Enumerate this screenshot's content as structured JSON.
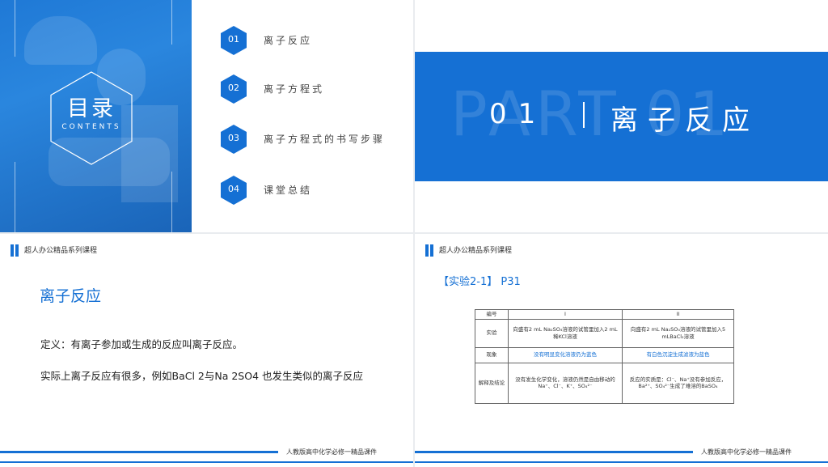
{
  "slide1": {
    "toc_title": "目录",
    "toc_subtitle": "CONTENTS",
    "items": [
      {
        "num": "01",
        "label": "离子反应"
      },
      {
        "num": "02",
        "label": "离子方程式"
      },
      {
        "num": "03",
        "label": "离子方程式的书写步骤"
      },
      {
        "num": "04",
        "label": "课堂总结"
      }
    ]
  },
  "slide2": {
    "bg_text": "PART 01",
    "num": "01",
    "title": "离子反应"
  },
  "slide3": {
    "header": "超人办公精品系列课程",
    "title": "离子反应",
    "para1": "定义：有离子参加或生成的反应叫离子反应。",
    "para2": "实际上离子反应有很多，例如BaCl 2与Na 2SO4 也发生类似的离子反应",
    "footer": "人教版高中化学必修一精品课件"
  },
  "slide4": {
    "header": "超人办公精品系列课程",
    "title": "【实验2-1】  P31",
    "footer": "人教版高中化学必修一精品课件",
    "table": {
      "head": [
        "编号",
        "I",
        "II"
      ],
      "rows": [
        {
          "label": "实验",
          "c1": "向盛有2 mL Na₂SO₄溶液的试管里加入2 mL稀KCl溶液",
          "c2": "向盛有2 mL Na₂SO₄溶液的试管里加入5 mLBaCl₂溶液"
        },
        {
          "label": "现象",
          "c1": "没有明显变化溶液仍为蓝色",
          "c2": "有白色沉淀生成滤液为蓝色"
        },
        {
          "label": "解释及结论",
          "c1": "没有发生化学变化，溶液仍然是自由移动的Na⁺、Cl⁻、K⁺、SO₄²⁻",
          "c2": "反应的实质是：Cl⁻、Na⁺没有参加反应，Ba²⁺、SO₄²⁻生成了难溶的BaSO₄"
        }
      ]
    }
  },
  "colors": {
    "accent": "#1570d4"
  }
}
